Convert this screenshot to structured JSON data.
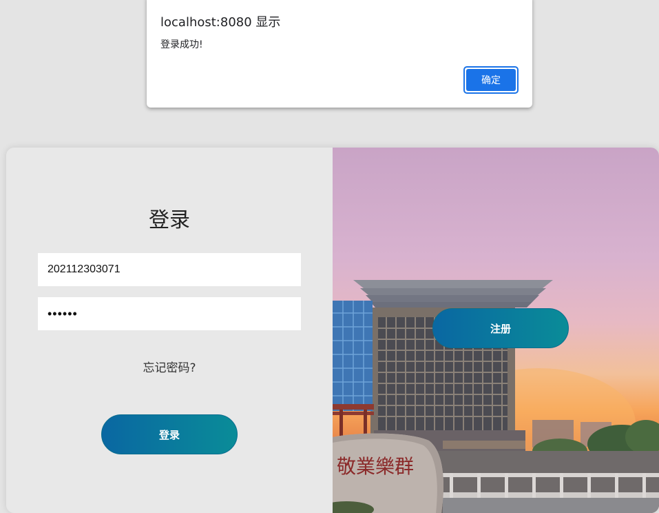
{
  "alert": {
    "title": "localhost:8080 显示",
    "message": "登录成功!",
    "ok_label": "确定"
  },
  "login": {
    "title": "登录",
    "username_value": "202112303071",
    "password_value": "••••••",
    "forgot_label": "忘记密码?",
    "login_button": "登录"
  },
  "side": {
    "register_button": "注册",
    "stone_inscription": "敬業樂群"
  },
  "colors": {
    "accent_blue": "#1a73e8",
    "button_gradient_start": "#0a67a2",
    "button_gradient_end": "#0a8c98",
    "background": "#e8e8e8"
  }
}
